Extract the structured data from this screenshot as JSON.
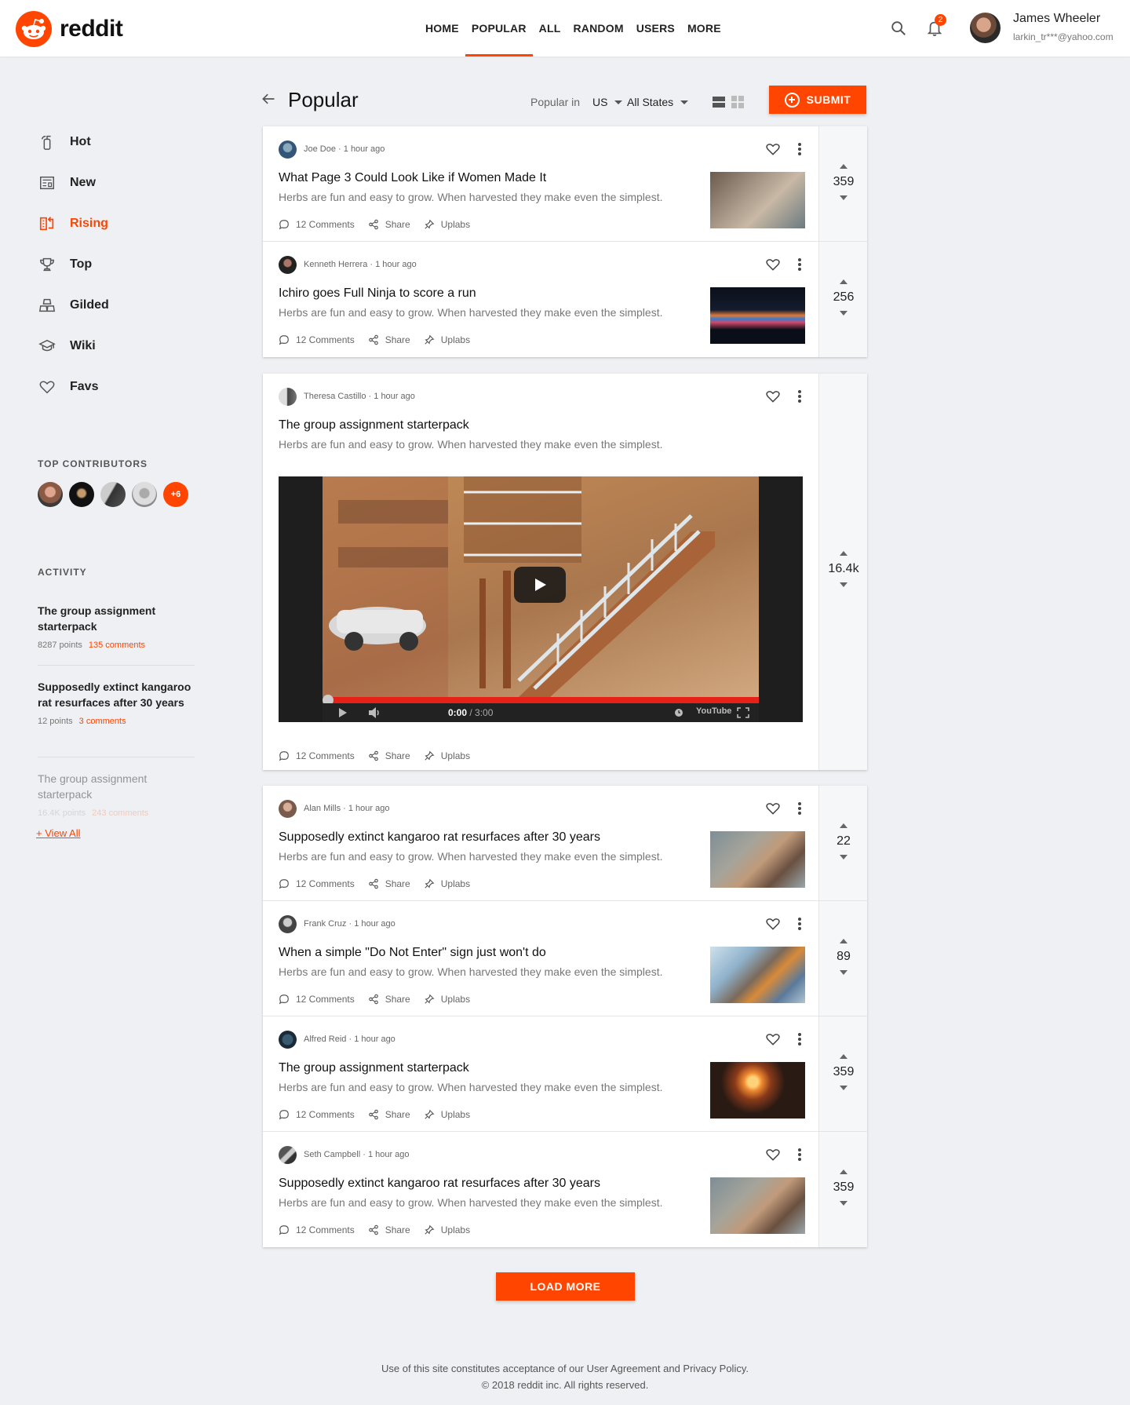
{
  "brand": {
    "name": "reddit"
  },
  "nav": [
    "HOME",
    "POPULAR",
    "ALL",
    "RANDOM",
    "USERS",
    "MORE"
  ],
  "nav_active": "POPULAR",
  "user": {
    "name": "James Wheeler",
    "email": "larkin_tr***@yahoo.com",
    "notifications": "2"
  },
  "sidebar": {
    "items": [
      {
        "label": "Hot",
        "icon": "fire-extinguisher-icon"
      },
      {
        "label": "New",
        "icon": "newspaper-icon"
      },
      {
        "label": "Rising",
        "icon": "rising-icon"
      },
      {
        "label": "Top",
        "icon": "trophy-icon"
      },
      {
        "label": "Gilded",
        "icon": "gold-bars-icon"
      },
      {
        "label": "Wiki",
        "icon": "graduation-cap-icon"
      },
      {
        "label": "Favs",
        "icon": "heart-icon"
      }
    ],
    "active": "Rising",
    "top_contributors_title": "TOP CONTRIBUTORS",
    "contributors_more": "+6",
    "activity_title": "ACTIVITY",
    "activity": [
      {
        "title": "The group assignment starterpack",
        "points": "8287 points",
        "comments": "135 comments"
      },
      {
        "title": "Supposedly extinct kangaroo rat resurfaces after 30 years",
        "points": "12 points",
        "comments": "3 comments"
      },
      {
        "title": "The group assignment starterpack",
        "points": "16.4K points",
        "comments": "243 comments"
      }
    ],
    "view_all": "View All"
  },
  "toolbar": {
    "title": "Popular",
    "popular_in": "Popular in",
    "country": "US",
    "state": "All States",
    "submit": "SUBMIT"
  },
  "actions": {
    "comments": "12 Comments",
    "share": "Share",
    "uplabs": "Uplabs"
  },
  "posts": [
    {
      "author": "Joe Doe",
      "time": "1 hour ago",
      "title": "What Page 3 Could Look Like if Women Made It",
      "text": "Herbs are fun and easy to grow. When harvested they make even the simplest.",
      "votes": "359"
    },
    {
      "author": "Kenneth Herrera",
      "time": "1 hour ago",
      "title": "Ichiro goes Full Ninja to score a run",
      "text": "Herbs are fun and easy to grow. When harvested they make even the simplest.",
      "votes": "256"
    },
    {
      "author": "Theresa Castillo",
      "time": "1 hour ago",
      "title": "The group assignment starterpack",
      "text": "Herbs are fun and easy to grow. When harvested they make even the simplest.",
      "votes": "16.4k"
    },
    {
      "author": "Alan Mills",
      "time": "1 hour ago",
      "title": "Supposedly extinct kangaroo rat resurfaces after 30 years",
      "text": "Herbs are fun and easy to grow. When harvested they make even the simplest.",
      "votes": "22"
    },
    {
      "author": "Frank Cruz",
      "time": "1 hour ago",
      "title": "When a simple \"Do Not Enter\" sign just won't do",
      "text": "Herbs are fun and easy to grow. When harvested they make even the simplest.",
      "votes": "89"
    },
    {
      "author": "Alfred Reid",
      "time": "1 hour ago",
      "title": "The group assignment starterpack",
      "text": "Herbs are fun and easy to grow. When harvested they make even the simplest.",
      "votes": "359"
    },
    {
      "author": "Seth Campbell",
      "time": "1 hour ago",
      "title": "Supposedly extinct kangaroo rat resurfaces after 30 years",
      "text": "Herbs are fun and easy to grow. When harvested they make even the simplest.",
      "votes": "359"
    }
  ],
  "video": {
    "time": "0:00",
    "duration": "/ 3:00",
    "logo": "YouTube"
  },
  "load_more": "LOAD MORE",
  "footer": {
    "line1": "Use of this site constitutes acceptance of our User Agreement and Privacy Policy.",
    "line2": "© 2018 reddit inc. All rights reserved."
  },
  "colors": {
    "accent": "#ff4500",
    "background": "#eef0f3"
  }
}
